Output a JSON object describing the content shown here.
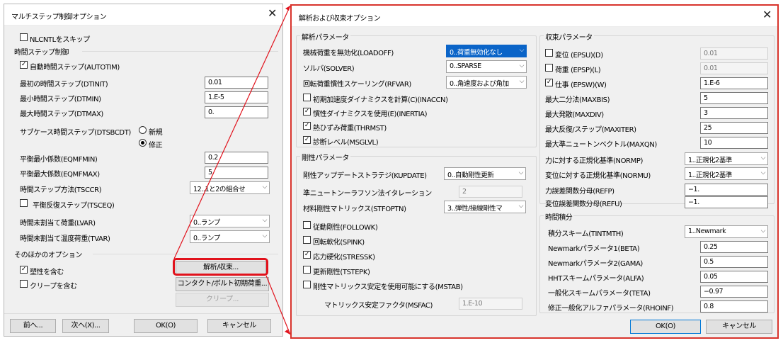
{
  "colors": {
    "highlight": "#e1121c",
    "selection": "#0a64c8"
  },
  "left": {
    "title": "マルチステップ制御オプション",
    "close": "✕",
    "skip_nlcntl": {
      "label": "NLCNTLをスキップ",
      "checked": false
    },
    "time_step_group": "時間ステップ制御",
    "autotim": {
      "label": "自動時間ステップ(AUTOTIM)",
      "checked": true
    },
    "dtinit": {
      "label": "最初の時間ステップ(DTINIT)",
      "value": "0.01"
    },
    "dtmin": {
      "label": "最小時間ステップ(DTMIN)",
      "value": "1.E-5"
    },
    "dtmax": {
      "label": "最大時間ステップ(DTMAX)",
      "value": "0."
    },
    "dtsbcdt": {
      "label": "サブケース時間ステップ(DTSBCDT)",
      "opt_new": "新規",
      "opt_mod": "修正",
      "selected": "修正"
    },
    "eqmfmin": {
      "label": "平衡最小係数(EQMFMIN)",
      "value": "0.2"
    },
    "eqmfmax": {
      "label": "平衡最大係数(EQMFMAX)",
      "value": "5."
    },
    "tsccr": {
      "label": "時間ステップ方法(TSCCR)",
      "value": "12..1と2の組合せ"
    },
    "tsceq": {
      "label": "平衡反復ステップ(TSCEQ)",
      "checked": false
    },
    "lvar": {
      "label": "時間未割当て荷重(LVAR)",
      "value": "0..ランプ"
    },
    "tvar": {
      "label": "時間未割当て温度荷重(TVAR)",
      "value": "0..ランプ"
    },
    "other_group": "そのほかのオプション",
    "plastic": {
      "label": "塑性を含む",
      "checked": true
    },
    "creep": {
      "label": "クリープを含む",
      "checked": false
    },
    "analysis_btn": "解析/収束...",
    "contact_btn": "コンタクト/ボルト初期荷重...",
    "creep_btn": "クリープ...",
    "prev_btn": "前へ...",
    "next_btn": "次へ(X)...",
    "ok_btn": "OK(O)",
    "cancel_btn": "キャンセル"
  },
  "right": {
    "title": "解析および収束オプション",
    "close": "✕",
    "analysis_group": "解析パラメータ",
    "loadoff": {
      "label": "機械荷重を無効化(LOADOFF)",
      "value": "0..荷重無効化なし"
    },
    "solver": {
      "label": "ソルバ(SOLVER)",
      "value": "0..SPARSE"
    },
    "rfvar": {
      "label": "回転荷重慣性スケーリング(RFVAR)",
      "value": "0..角速度および角加"
    },
    "inaccn": {
      "label": "初期加速度ダイナミクスを計算(C)(INACCN)",
      "checked": false
    },
    "inertia": {
      "label": "慣性ダイナミクスを使用(E)(INERTIA)",
      "checked": true
    },
    "thrmst": {
      "label": "熱ひずみ荷重(THRMST)",
      "checked": true
    },
    "msglvl": {
      "label": "診断レベル(MSGLVL)",
      "checked": true
    },
    "stiff_group": "剛性パラメータ",
    "kupdate": {
      "label": "剛性アップデートストラテジ(KUPDATE)",
      "value": "0..自動剛性更新"
    },
    "quasi_newton": {
      "label": "準ニュートンーラフソン法イタレーション",
      "value": "2"
    },
    "stfoptn": {
      "label": "材料剛性マトリックス(STFOPTN)",
      "value": "3..弾性/接線剛性マ"
    },
    "followk": {
      "label": "従動剛性(FOLLOWK)",
      "checked": false
    },
    "spink": {
      "label": "回転軟化(SPINK)",
      "checked": false
    },
    "stressk": {
      "label": "応力硬化(STRESSK)",
      "checked": true
    },
    "tstepk": {
      "label": "更新剛性(TSTEPK)",
      "checked": false
    },
    "mstab": {
      "label": "剛性マトリックス安定を使用可能にする(MSTAB)",
      "checked": false
    },
    "msfac": {
      "label": "マトリックス安定ファクタ(MSFAC)",
      "value": "1.E-10"
    },
    "conv_group": "収束パラメータ",
    "epsu": {
      "label": "変位 (EPSU)(D)",
      "value": "0.01",
      "checked": false
    },
    "epsp": {
      "label": "荷重 (EPSP)(L)",
      "value": "0.01",
      "checked": false
    },
    "epsw": {
      "label": "仕事 (EPSW)(W)",
      "value": "1.E-6",
      "checked": true
    },
    "maxbis": {
      "label": "最大二分法(MAXBIS)",
      "value": "5"
    },
    "maxdiv": {
      "label": "最大発散(MAXDIV)",
      "value": "3"
    },
    "maxiter": {
      "label": "最大反復/ステップ(MAXITER)",
      "value": "25"
    },
    "maxqn": {
      "label": "最大準ニュートンベクトル(MAXQN)",
      "value": "10"
    },
    "normp": {
      "label": "力に対する正規化基準(NORMP)",
      "value": "1..正規化2基準"
    },
    "normu": {
      "label": "変位に対する正規化基準(NORMU)",
      "value": "1..正規化2基準"
    },
    "refp": {
      "label": "力誤差関数分母(REFP)",
      "value": "−1."
    },
    "refu": {
      "label": "変位誤差関数分母(REFU)",
      "value": "−1."
    },
    "time_group": "時間積分",
    "tintmth": {
      "label": "積分スキーム(TINTMTH)",
      "value": "1..Newmark"
    },
    "beta": {
      "label": "Newmarkパラメータ1(BETA)",
      "value": "0.25"
    },
    "gama": {
      "label": "Newmarkパラメータ2(GAMA)",
      "value": "0.5"
    },
    "alfa": {
      "label": "HHTスキームパラメータ(ALFA)",
      "value": "0.05"
    },
    "teta": {
      "label": "一般化スキームパラメータ(TETA)",
      "value": "−0.97"
    },
    "rhoinf": {
      "label": "修正一般化アルファパラメータ(RHOINF)",
      "value": "0.8"
    },
    "ok_btn": "OK(O)",
    "cancel_btn": "キャンセル"
  }
}
